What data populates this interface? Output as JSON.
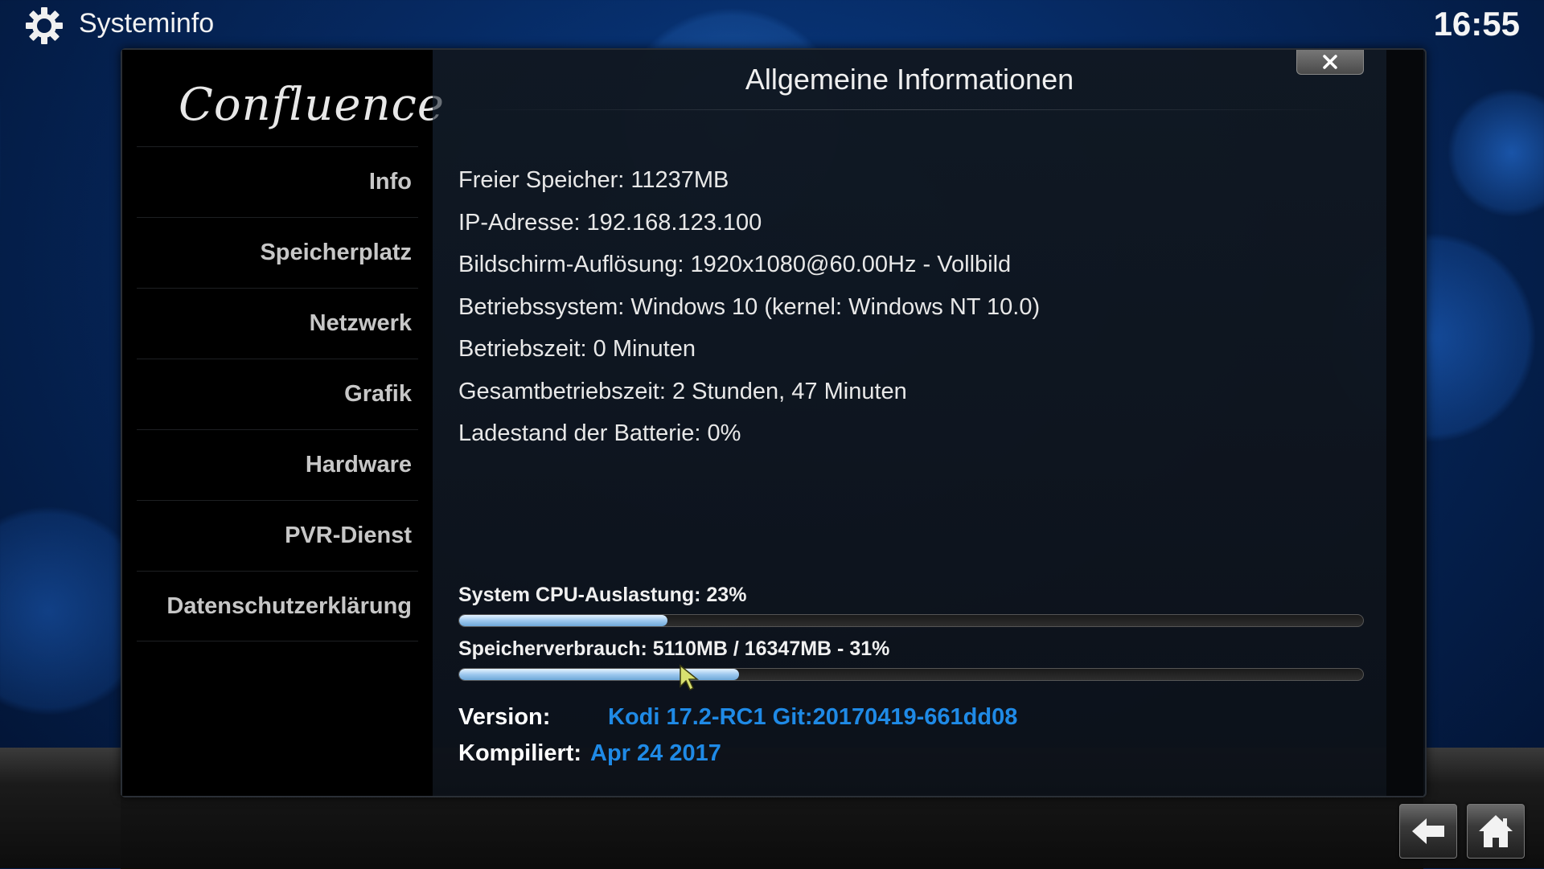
{
  "header": {
    "title": "Systeminfo",
    "clock": "16:55"
  },
  "sidebar": {
    "logo": "Confluence",
    "items": [
      {
        "label": "Info"
      },
      {
        "label": "Speicherplatz"
      },
      {
        "label": "Netzwerk"
      },
      {
        "label": "Grafik"
      },
      {
        "label": "Hardware"
      },
      {
        "label": "PVR-Dienst"
      },
      {
        "label": "Datenschutzerklärung"
      }
    ]
  },
  "dialog": {
    "title": "Allgemeine Informationen",
    "info": [
      "Freier Speicher: 11237MB",
      "IP-Adresse: 192.168.123.100",
      "Bildschirm-Auflösung: 1920x1080@60.00Hz - Vollbild",
      "Betriebssystem: Windows 10 (kernel: Windows NT 10.0)",
      "Betriebszeit: 0 Minuten",
      "Gesamtbetriebszeit: 2 Stunden, 47 Minuten",
      "Ladestand der Batterie: 0%"
    ],
    "cpu": {
      "label": "System CPU-Auslastung: 23%",
      "percent": 23
    },
    "memory": {
      "label": "Speicherverbrauch: 5110MB / 16347MB - 31%",
      "percent": 31
    },
    "version": {
      "label": "Version:",
      "value": "Kodi 17.2-RC1 Git:20170419-661dd08"
    },
    "compiled": {
      "label": "Kompiliert:",
      "value": "Apr 24 2017"
    }
  },
  "colors": {
    "accent": "#1f8ae6",
    "background": "#062a63",
    "bar_fill": "#9dc8ee"
  },
  "icons": {
    "header": "gear-icon",
    "close": "close-icon",
    "back": "back-arrow-icon",
    "home": "home-icon"
  }
}
